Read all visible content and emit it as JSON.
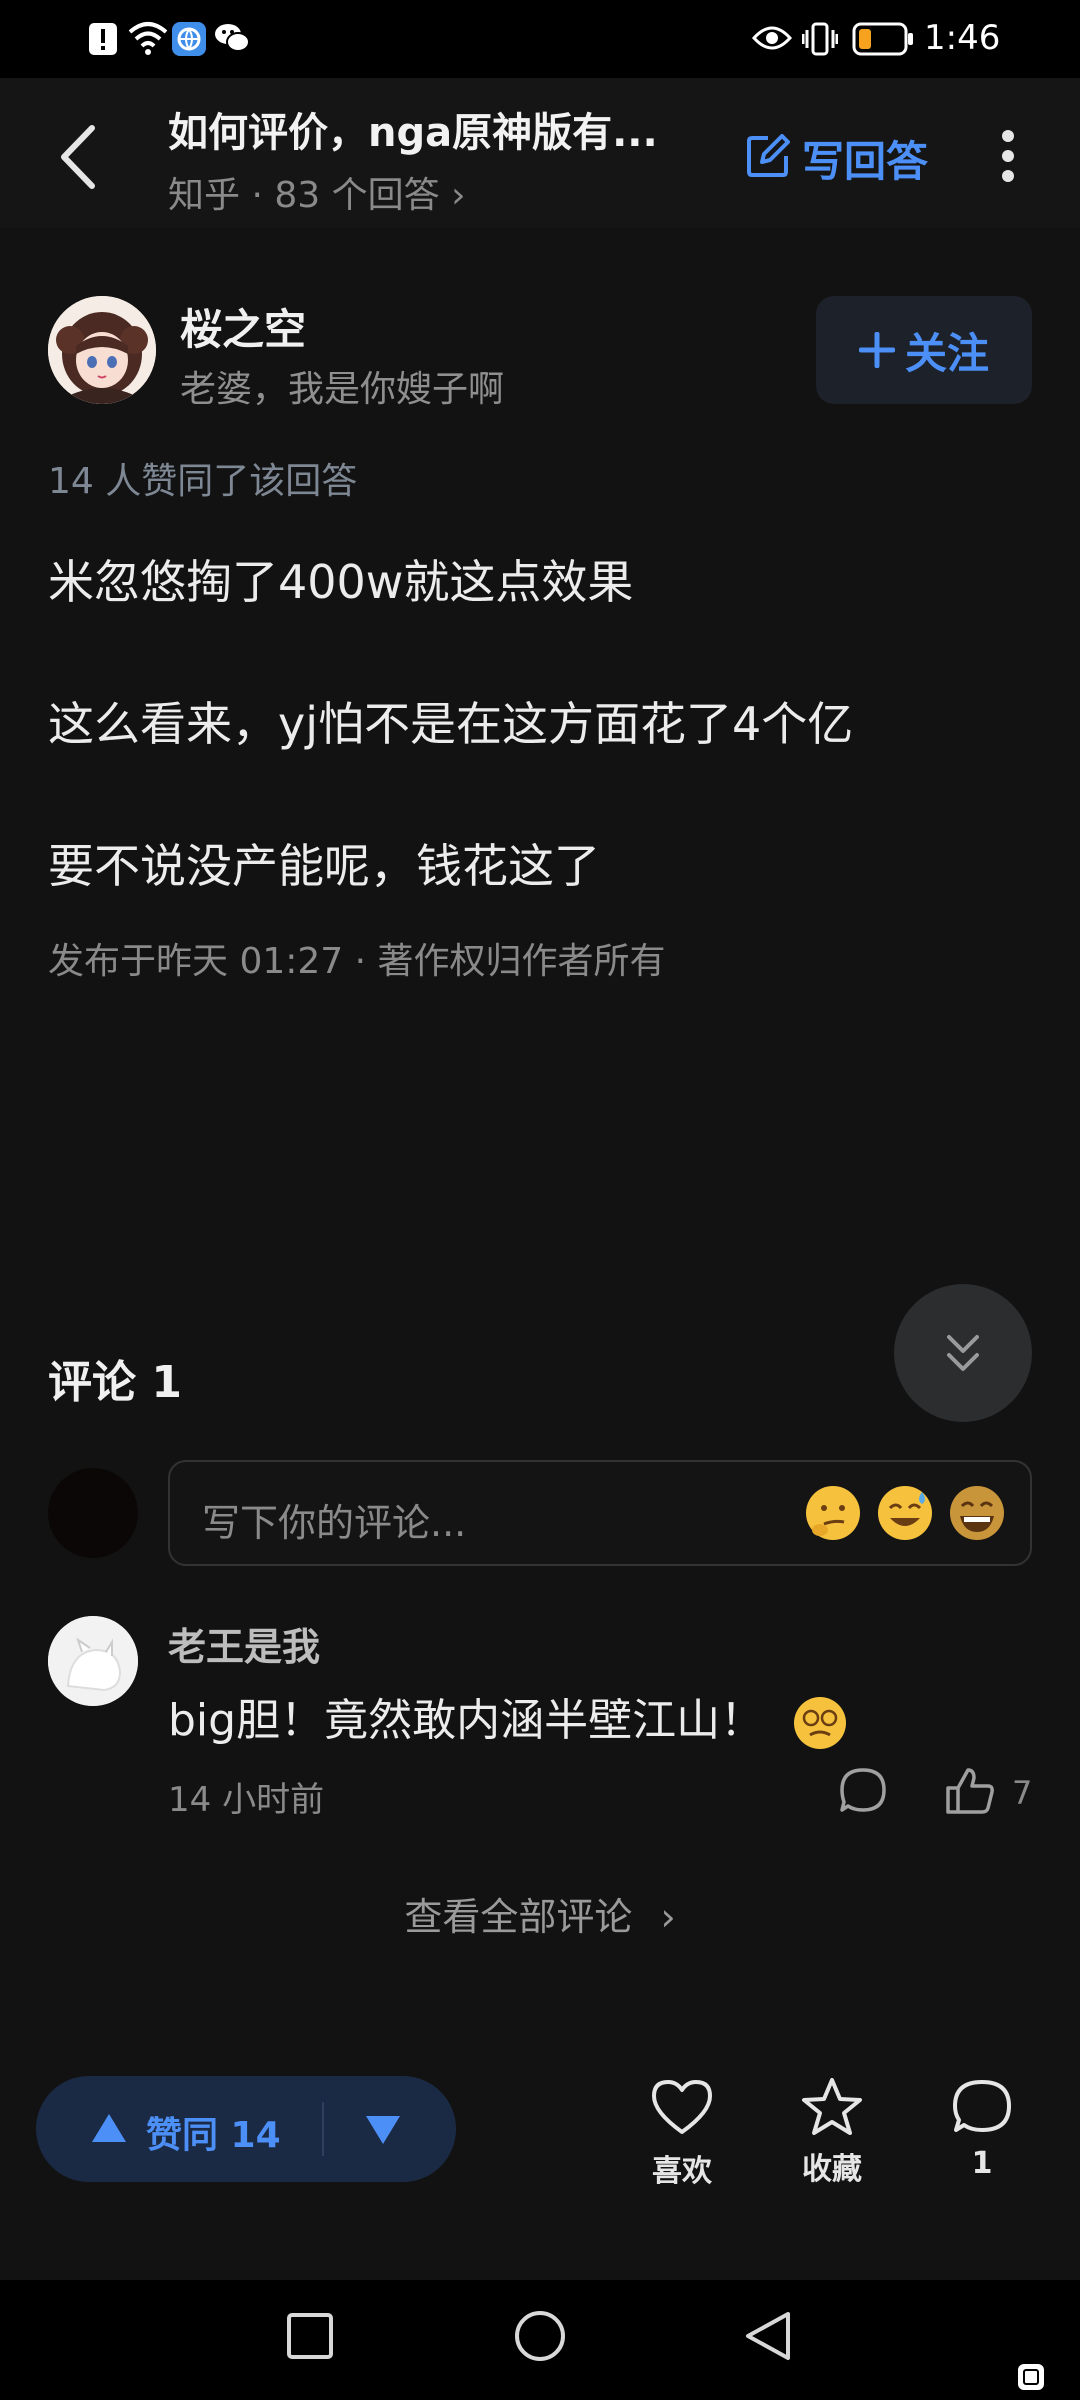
{
  "status_bar": {
    "time": "1:46",
    "icons": [
      "alert-icon",
      "wifi-icon",
      "browser-icon",
      "wechat-icon",
      "eye-icon",
      "vibrate-icon",
      "battery-icon"
    ],
    "colors": {
      "battery_low": "#f6a21e"
    }
  },
  "header": {
    "title": "如何评价，nga原神版有...",
    "source": "知乎",
    "answers_count": "83 个回答",
    "write_answer_label": "写回答"
  },
  "author": {
    "name": "桜之空",
    "bio": "老婆，我是你嫂子啊",
    "follow_label": "关注"
  },
  "answer": {
    "likes_text": "14 人赞同了该回答",
    "paragraphs": [
      "米忽悠掏了400w就这点效果",
      "这么看来，yj怕不是在这方面花了4个亿",
      "要不说没产能呢，钱花这了"
    ],
    "published": "发布于昨天 01:27",
    "copyright": "著作权归作者所有"
  },
  "comments": {
    "heading": "评论 1",
    "input_placeholder": "写下你的评论...",
    "items": [
      {
        "user": "老王是我",
        "text": "big胆！竟然敢内涵半壁江山！",
        "time": "14 小时前",
        "likes": "7"
      }
    ],
    "view_all_label": "查看全部评论"
  },
  "action_bar": {
    "upvote_label": "赞同 14",
    "like_label": "喜欢",
    "collect_label": "收藏",
    "comment_count": "1"
  },
  "colors": {
    "accent": "#4c8ff6",
    "background": "#121212",
    "vote_bg": "#1b2a44"
  }
}
